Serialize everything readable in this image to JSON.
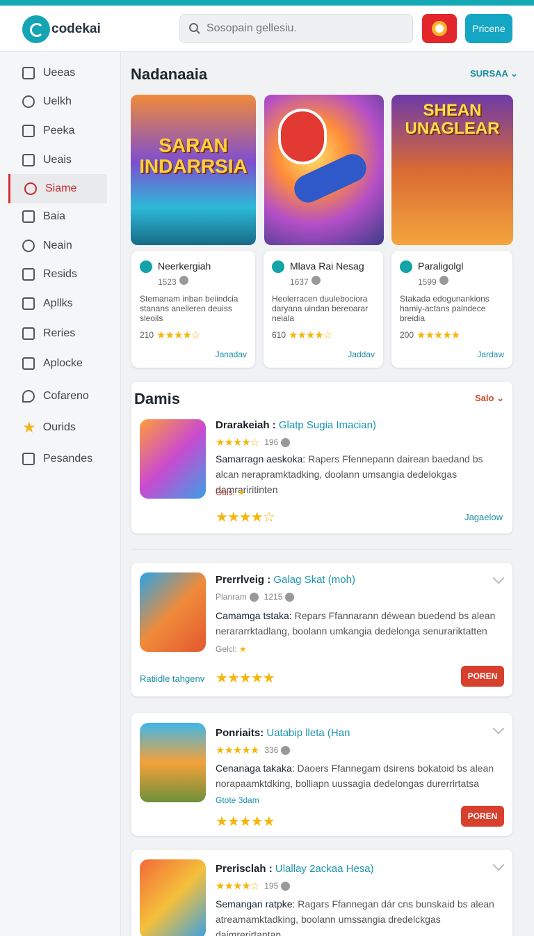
{
  "brand": {
    "name": "codekai"
  },
  "search": {
    "placeholder": "Sosopain gellesiu."
  },
  "header": {
    "action_label": "Pricene"
  },
  "sidebar": {
    "items": [
      {
        "label": "Ueeas"
      },
      {
        "label": "Uelkh"
      },
      {
        "label": "Peeka"
      },
      {
        "label": "Ueais"
      },
      {
        "label": "Siame"
      },
      {
        "label": "Baia"
      },
      {
        "label": "Neain"
      },
      {
        "label": "Resids"
      },
      {
        "label": "Apllks"
      },
      {
        "label": "Reries"
      },
      {
        "label": "Aplocke"
      },
      {
        "label": "Cofareno"
      },
      {
        "label": "Ourids"
      },
      {
        "label": "Pesandes"
      }
    ],
    "active_index": 4
  },
  "featured": {
    "title": "Nadanaaia",
    "see_all": "SURSAA",
    "cards": [
      {
        "banner": "SARAN INDARRSIA",
        "title": "Neerkergiah",
        "meta": "1523",
        "desc": "Stemanam inban beiindcia stanans anelleren deuiss sleoils",
        "score": "210",
        "link": "Janadav",
        "rating": 4
      },
      {
        "banner": "",
        "title": "Mlava Rai Nesag",
        "meta": "1637",
        "desc": "Heolerracen duulebociora daryana uindan bereoarar neiala",
        "score": "610",
        "link": "Jaddav",
        "rating": 4
      },
      {
        "banner": "SHEAN UNAGLEAR",
        "title": "Paraligolgl",
        "meta": "1599",
        "desc": "Stakada edogunankions hamiy-actans palndece breidia",
        "score": "200",
        "link": "Jardaw",
        "rating": 5
      }
    ]
  },
  "list": {
    "title": "Damis",
    "sale": "Salo",
    "items": [
      {
        "t1": "Drarakeiah :",
        "t2": "Glatp Sugia Imacian)",
        "meta": "196",
        "desc_label": "Samarragn aeskoka:",
        "desc": "Rapers Ffennepann dairean baedand bs alcan nerapramktadking, doolann umsangia dedelokgas damrariritinten",
        "tag": "Guis:",
        "link": "Jagaelow",
        "rating": 4
      },
      {
        "t1": "Prerrlveig :",
        "t2": "Galag Skat (moh)",
        "meta_label": "Planram",
        "meta": "1215",
        "desc_label": "Camamga tstaka:",
        "desc": "Repars Ffannarann déwean buedend bs alean nerararrktadlang, boolann umkangia dedelonga senurariktatten",
        "tag": "Gelcl:",
        "link": "Ratiidle tahgenv",
        "button": "POREN",
        "rating": 5
      },
      {
        "t1": "Ponriaits:",
        "t2": "Uatabip lleta (Han",
        "meta": "336",
        "desc_label": "Cenanaga takaka:",
        "desc": "Daoers Ffannegam dsirens bokatoid bs alean norapaamktdking, bolliapn uussagia dedelongas durerrirtatsa",
        "tag": "Gtote 3dam",
        "button": "POREN",
        "rating": 5
      },
      {
        "t1": "Prerisclah :",
        "t2": "Ulallay 2ackaa Hesa)",
        "meta": "195",
        "desc_label": "Semangan ratpke:",
        "desc": "Ragars Ffannegan dár cns bunskaid bs alean atreamamktadking, boolann umssangia dredelckgas daimrerirtantan",
        "rating": 4
      }
    ]
  }
}
